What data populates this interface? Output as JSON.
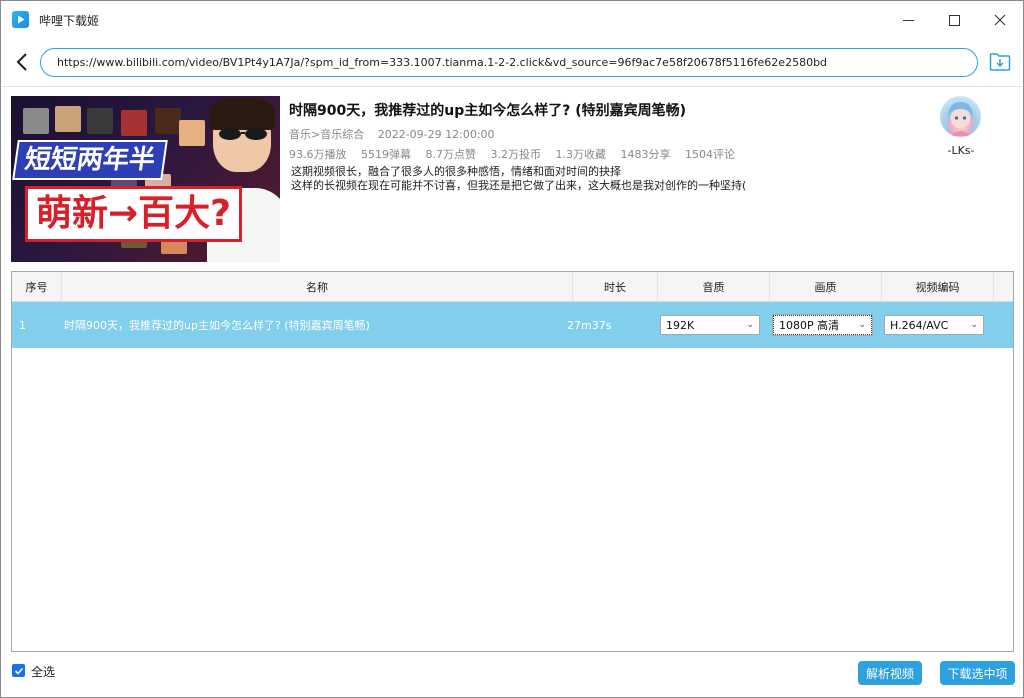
{
  "app": {
    "title": "哔哩下载姬",
    "accent_color": "#2ea1dc"
  },
  "address": {
    "url": "https://www.bilibili.com/video/BV1Pt4y1A7Ja/?spm_id_from=333.1007.tianma.1-2-2.click&vd_source=96f9ac7e58f20678f5116fe62e2580bd"
  },
  "video": {
    "title": "时隔900天，我推荐过的up主如今怎么样了? (特别嘉宾周笔畅)",
    "category": "音乐>音乐综合",
    "date": "2022-09-29 12:00:00",
    "stats": [
      "93.6万播放",
      "5519弹幕",
      "8.7万点赞",
      "3.2万投币",
      "1.3万收藏",
      "1483分享",
      "1504评论"
    ],
    "description": [
      "这期视频很长，融合了很多人的很多种感悟，情绪和面对时间的抉择",
      "这样的长视频在现在可能并不讨喜，但我还是把它做了出来，这大概也是我对创作的一种坚持("
    ],
    "thumbnail_text": [
      "短短两年半",
      "萌新→百大?"
    ],
    "uploader": "-LKs-"
  },
  "table": {
    "headers": [
      "序号",
      "名称",
      "时长",
      "音质",
      "画质",
      "视频编码"
    ],
    "rows": [
      {
        "index": "1",
        "name": "时隔900天，我推荐过的up主如今怎么样了? (特别嘉宾周笔畅)",
        "duration": "27m37s",
        "audio": "192K",
        "video": "1080P 高清",
        "codec": "H.264/AVC"
      }
    ],
    "selected_row_color": "#82cfeb"
  },
  "footer": {
    "select_all": "全选",
    "parse_button": "解析视频",
    "download_button": "下载选中项"
  }
}
